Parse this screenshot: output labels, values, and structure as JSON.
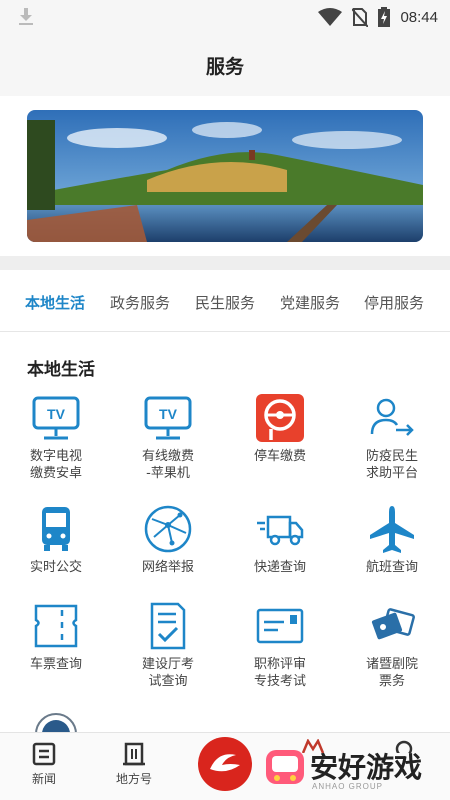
{
  "status_bar": {
    "time": "08:44"
  },
  "header": {
    "title": "服务"
  },
  "tabs": [
    {
      "label": "本地生活",
      "active": true
    },
    {
      "label": "政务服务",
      "active": false
    },
    {
      "label": "民生服务",
      "active": false
    },
    {
      "label": "党建服务",
      "active": false
    },
    {
      "label": "停用服务",
      "active": false
    }
  ],
  "section": {
    "title": "本地生活"
  },
  "services": [
    {
      "label": "数字电视\n缴费安卓",
      "icon": "tv-icon"
    },
    {
      "label": "有线缴费\n-苹果机",
      "icon": "tv-icon"
    },
    {
      "label": "停车缴费",
      "icon": "parking-icon"
    },
    {
      "label": "防疫民生\n求助平台",
      "icon": "user-arrow-icon"
    },
    {
      "label": "实时公交",
      "icon": "bus-icon"
    },
    {
      "label": "网络举报",
      "icon": "network-globe-icon"
    },
    {
      "label": "快递查询",
      "icon": "delivery-truck-icon"
    },
    {
      "label": "航班查询",
      "icon": "airplane-icon"
    },
    {
      "label": "车票查询",
      "icon": "ticket-icon"
    },
    {
      "label": "建设厅考\n试查询",
      "icon": "checklist-icon"
    },
    {
      "label": "职称评审\n专技考试",
      "icon": "envelope-icon"
    },
    {
      "label": "诸暨剧院\n票务",
      "icon": "theater-tickets-icon"
    }
  ],
  "bottom_nav": [
    {
      "label": "新闻",
      "icon": "news-icon"
    },
    {
      "label": "地方号",
      "icon": "building-icon"
    }
  ],
  "watermark": {
    "text": "安好游戏",
    "sub": "ANHAO GROUP"
  },
  "colors": {
    "accent": "#1e86c8",
    "parking": "#e8412c",
    "brand": "#d9251d"
  }
}
